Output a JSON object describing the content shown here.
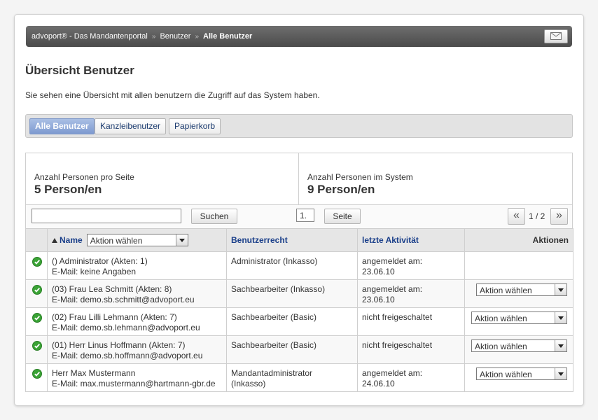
{
  "breadcrumb": {
    "items": [
      "advoport® - Das Mandantenportal",
      "Benutzer"
    ],
    "current": "Alle Benutzer",
    "separator": "»"
  },
  "icons": {
    "mail": "mail-icon",
    "check": "check-circle-icon",
    "sort": "sort-asc-icon"
  },
  "colors": {
    "accent": "#7e9ad0",
    "link": "#1a3f8a",
    "check": "#3aa335"
  },
  "page": {
    "title": "Übersicht Benutzer",
    "intro": "Sie sehen eine Übersicht mit allen benutzern die Zugriff auf das System haben."
  },
  "tabs": [
    {
      "label": "Alle Benutzer",
      "active": true
    },
    {
      "label": "Kanzleibenutzer",
      "active": false
    },
    {
      "label": "Papierkorb",
      "active": false
    }
  ],
  "stats": {
    "per_page_label": "Anzahl Personen pro Seite",
    "per_page_value": "5 Person/en",
    "total_label": "Anzahl Personen im System",
    "total_value": "9 Person/en"
  },
  "toolbar": {
    "search_value": "",
    "search_button": "Suchen",
    "page_value": "1.",
    "page_button": "Seite",
    "prev": "«",
    "next": "»",
    "page_count": "1 / 2"
  },
  "table": {
    "headers": {
      "name": "Name",
      "name_select": "Aktion wählen",
      "rights": "Benutzerrecht",
      "activity": "letzte Aktivität",
      "actions": "Aktionen"
    },
    "rows": [
      {
        "name": "() Administrator (Akten: 1)",
        "email": "E-Mail: keine Angaben",
        "rights1": "Administrator (Inkasso)",
        "rights2": "",
        "activity1": "angemeldet am:",
        "activity2": "23.06.10",
        "action": ""
      },
      {
        "name": "(03) Frau Lea Schmitt (Akten: 8)",
        "email": "E-Mail: demo.sb.schmitt@advoport.eu",
        "rights1": "Sachbearbeiter (Inkasso)",
        "rights2": "",
        "activity1": "angemeldet am:",
        "activity2": "23.06.10",
        "action": "Aktion wählen"
      },
      {
        "name": "(02) Frau Lilli Lehmann (Akten: 7)",
        "email": "E-Mail: demo.sb.lehmann@advoport.eu",
        "rights1": "Sachbearbeiter (Basic)",
        "rights2": "",
        "activity1": "nicht freigeschaltet",
        "activity2": "",
        "action": "Aktion wählen"
      },
      {
        "name": "(01) Herr Linus Hoffmann (Akten: 7)",
        "email": "E-Mail: demo.sb.hoffmann@advoport.eu",
        "rights1": "Sachbearbeiter (Basic)",
        "rights2": "",
        "activity1": "nicht freigeschaltet",
        "activity2": "",
        "action": "Aktion wählen"
      },
      {
        "name": "Herr Max Mustermann",
        "email": "E-Mail: max.mustermann@hartmann-gbr.de",
        "rights1": "Mandantadministrator",
        "rights2": "(Inkasso)",
        "activity1": "angemeldet am:",
        "activity2": "24.06.10",
        "action": "Aktion wählen"
      }
    ]
  }
}
